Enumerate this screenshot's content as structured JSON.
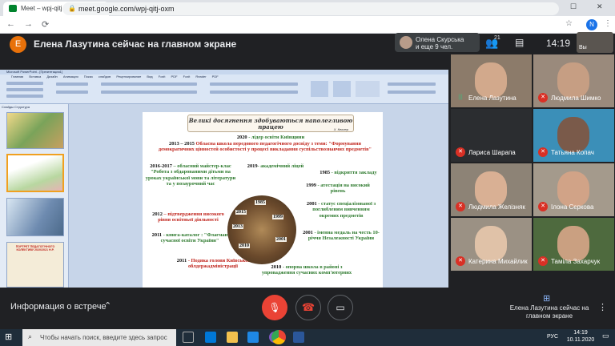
{
  "browser": {
    "tab_title": "Meet – wpj-qitj-oxm",
    "url": "meet.google.com/wpj-qitj-oxm",
    "profile_initial": "N",
    "new_tab": "+",
    "close_tab": "×",
    "minimize": "—",
    "maximize": "☐",
    "close_window": "✕"
  },
  "meet": {
    "presenter_initial": "E",
    "presenting_text": "Елена Лазутина сейчас на главном экране",
    "participants_preview": {
      "line1": "Олена Скурська",
      "line2": "и еще 9 чел."
    },
    "people_count": "21",
    "clock": "14:19",
    "self_label": "Вы",
    "meeting_info": "Информация о встрече",
    "present_text": "Елена Лазутина сейчас на главном экране",
    "tiles": [
      {
        "name": "Елена Лазутина",
        "muted": false
      },
      {
        "name": "Людмила Шимко",
        "muted": true
      },
      {
        "name": "Лариса Шарапа",
        "muted": true
      },
      {
        "name": "Татьяна Копач",
        "muted": true
      },
      {
        "name": "Людмила Желізняк",
        "muted": true
      },
      {
        "name": "Ілона Сєркова",
        "muted": true
      },
      {
        "name": "Катерина Михайлик",
        "muted": true
      },
      {
        "name": "Тамiла Захарчук",
        "muted": true
      }
    ]
  },
  "powerpoint": {
    "title": "Microsoft PowerPoint - [Презентация1]",
    "ribbon_tabs": "Главная Вставка Дизайн Анимация Показ слайдов Рецензирование Вид Foxit PDF Foxit Reader PDF",
    "panel_tabs": "Слайды  Структура",
    "slide": {
      "banner_title": "Великі досягнення здобуваються наполегливою працею",
      "banner_author": "Х. Келлер",
      "items": {
        "y2020": "2020",
        "t2020": " - лідер освіти Київщини",
        "y2013": "2013 – 2015",
        "t2013": " Обласна школа передового педагогічного досвіду з теми: \"Формування демократичних цінностей особистості у процесі викладання суспільствознавчих предметів\"",
        "y2016": "2016-2017",
        "t2016": " – обласний майстер-клас \"Робота з обдарованими дітьми на уроках української мови та літератури та у позаурочний час",
        "y2019": "2019",
        "t2019": "- академічний ліцей",
        "y1985": "1985",
        "t1985": " - відкриття закладу",
        "y1999": "1999",
        "t1999": " - атестація на високий рівень",
        "y2012": "2012",
        "t2012": " – підтвердження високого рівня освітньої діяльності",
        "y2011a": "2011",
        "t2011a": " - книга-каталог : \"Флагман сучасної освіти України\"",
        "y2001a": "2001",
        "t2001a": " - статус спеціалізованої з поглибленим вивченням окремих предметів",
        "y2001b": "2001",
        "t2001b": " - іменна медаль на честь 10-річчя Незалежності України",
        "y2011b": "2011",
        "t2011b": " - Подяка голови Київської облдержадміністрації",
        "y2010": "2010",
        "t2010": " - опорна школа в районі з упровадження сучасних комп'ютерних"
      },
      "clock_years": [
        "1985",
        "1999",
        "2013",
        "2015",
        "2010",
        "2001"
      ]
    },
    "thumbnails": [
      "slide-1",
      "slide-2",
      "slide-3",
      "slide-4"
    ],
    "thumb4_title": "ПОРТРЕТ ПЕДАГОГІЧНОГО КОЛЕКТИВУ 2020/2021 Н.Р."
  },
  "taskbar": {
    "search_placeholder": "Чтобы начать поиск, введите здесь запрос",
    "lang": "РУС",
    "time": "14:19",
    "date": "10.11.2020"
  },
  "colors": {
    "meet_bg": "#202124",
    "hangup_red": "#ea4335",
    "slide_green": "#2e7a2e",
    "slide_red": "#c0241c"
  }
}
